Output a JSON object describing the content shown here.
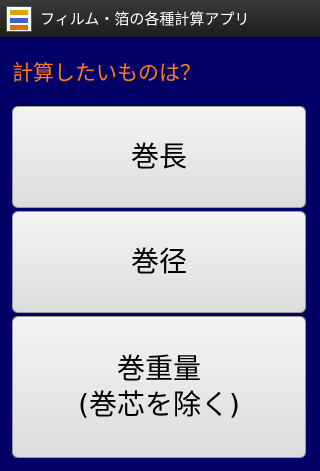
{
  "titlebar": {
    "app_icon": "film-foil-app-icon",
    "title": "フィルム・箔の各種計算アプリ"
  },
  "prompt": "計算したいものは？",
  "buttons": [
    {
      "label": "巻長"
    },
    {
      "label": "巻径"
    },
    {
      "label_line1": "巻重量",
      "label_line2": "(巻芯を除く)"
    }
  ],
  "colors": {
    "background": "#000066",
    "prompt_text": "#ff7a1a",
    "button_face": "#e8e8e8"
  }
}
